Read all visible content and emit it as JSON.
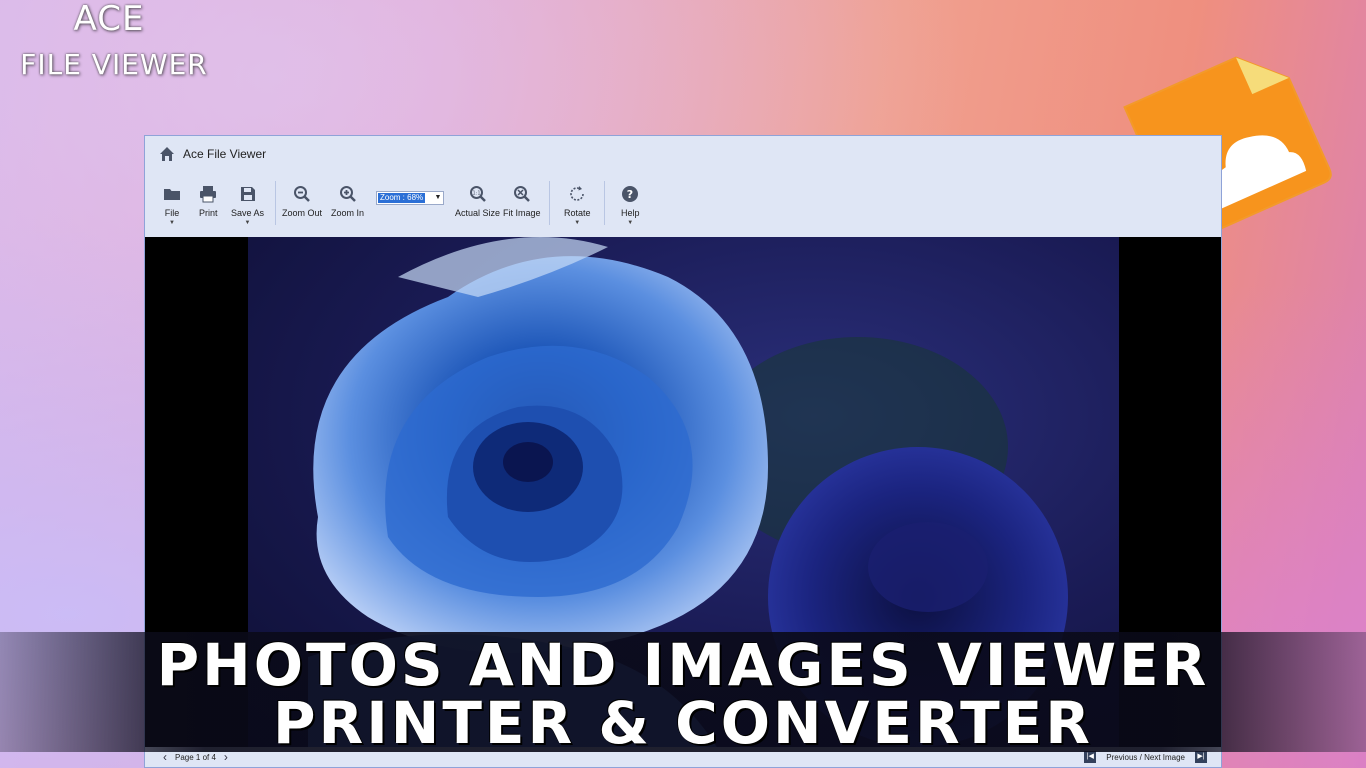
{
  "brand": {
    "line1": "ACE",
    "line2": "FILE VIEWER"
  },
  "window": {
    "title": "Ace File Viewer"
  },
  "toolbar": {
    "file": "File",
    "print": "Print",
    "save_as": "Save As",
    "zoom_out": "Zoom Out",
    "zoom_in": "Zoom In",
    "zoom_value": "Zoom : 68%",
    "actual_size": "Actual Size",
    "fit_image": "Fit Image",
    "rotate": "Rotate",
    "help": "Help"
  },
  "status": {
    "page": "Page 1 of 4",
    "nav_label": "Previous / Next Image"
  },
  "headline": {
    "line1": "PHOTOS AND IMAGES VIEWER",
    "line2": "PRINTER & CONVERTER"
  },
  "colors": {
    "logo_orange": "#f7941d",
    "accent_blue": "#2b6fd6",
    "toolbar_bg": "#dfe6f5"
  },
  "icons": [
    "home-icon",
    "folder-icon",
    "printer-icon",
    "save-icon",
    "zoom-out-icon",
    "zoom-in-icon",
    "actual-size-icon",
    "fit-image-icon",
    "rotate-icon",
    "help-icon",
    "image-file-icon"
  ]
}
